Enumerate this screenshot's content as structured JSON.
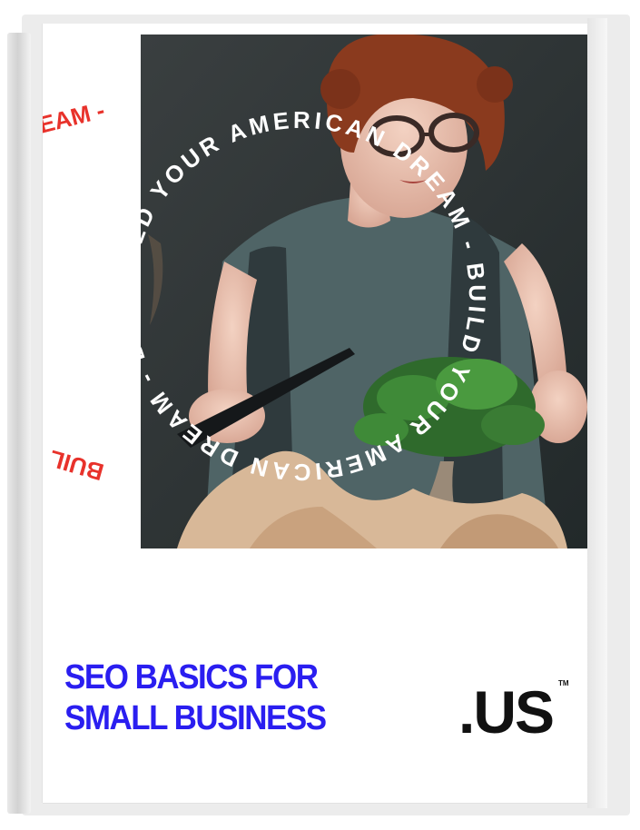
{
  "cover": {
    "title_line1": "SEO BASICS FOR",
    "title_line2": "SMALL BUSINESS",
    "logo": ".US",
    "trademark": "TM"
  },
  "circular_slogan": "BUILD YOUR AMERICAN DREAM - BUILD YOUR AMERICAN DREAM - BUILD YOUR AMERICAN DREAM - ",
  "photo": {
    "subject": "woman-pruning-bonsai",
    "icon": "photo-icon"
  },
  "colors": {
    "title_blue": "#2a1ef0",
    "slogan_red": "#e8322b",
    "slogan_white": "#ffffff",
    "logo_black": "#111111",
    "photo_bg": "#2e3334"
  }
}
